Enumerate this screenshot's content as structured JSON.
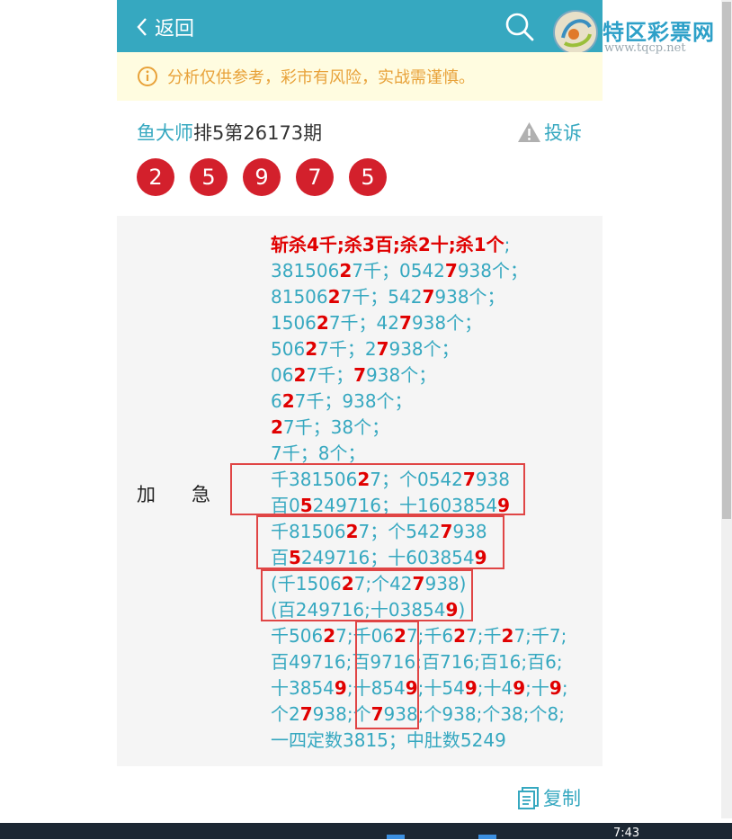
{
  "header": {
    "back_label": "返回"
  },
  "brand": {
    "name": "特区彩票网",
    "url": "www.tqcp.net"
  },
  "notice": {
    "text": "分析仅供参考，彩市有风险，实战需谨慎。"
  },
  "post": {
    "author": "鱼大师",
    "title": "排5第26173期",
    "complain_label": "投诉",
    "balls": [
      "2",
      "5",
      "9",
      "7",
      "5"
    ],
    "tag": "加急",
    "copy_label": "复制"
  },
  "content": {
    "lines": [
      [
        [
          "斩杀4千;杀3百;杀2十;杀1个",
          true
        ],
        [
          ";",
          false
        ]
      ],
      [
        [
          "381506",
          false
        ],
        [
          "2",
          true
        ],
        [
          "7千；0542",
          false
        ],
        [
          "7",
          true
        ],
        [
          "938个；",
          false
        ]
      ],
      [
        [
          "81506",
          false
        ],
        [
          "2",
          true
        ],
        [
          "7千；542",
          false
        ],
        [
          "7",
          true
        ],
        [
          "938个；",
          false
        ]
      ],
      [
        [
          "1506",
          false
        ],
        [
          "2",
          true
        ],
        [
          "7千；42",
          false
        ],
        [
          "7",
          true
        ],
        [
          "938个；",
          false
        ]
      ],
      [
        [
          "506",
          false
        ],
        [
          "2",
          true
        ],
        [
          "7千；2",
          false
        ],
        [
          "7",
          true
        ],
        [
          "938个；",
          false
        ]
      ],
      [
        [
          "06",
          false
        ],
        [
          "2",
          true
        ],
        [
          "7千；",
          false
        ],
        [
          "7",
          true
        ],
        [
          "938个；",
          false
        ]
      ],
      [
        [
          "6",
          false
        ],
        [
          "2",
          true
        ],
        [
          "7千；938个；",
          false
        ]
      ],
      [
        [
          "2",
          true
        ],
        [
          "7千；38个；",
          false
        ]
      ],
      [
        [
          "7千；8个；",
          false
        ]
      ],
      [
        [
          "千381506",
          false
        ],
        [
          "2",
          true
        ],
        [
          "7；个0542",
          false
        ],
        [
          "7",
          true
        ],
        [
          "938",
          false
        ]
      ],
      [
        [
          "百0",
          false
        ],
        [
          "5",
          true
        ],
        [
          "249716；十1603854",
          false
        ],
        [
          "9",
          true
        ]
      ],
      [
        [
          "千81506",
          false
        ],
        [
          "2",
          true
        ],
        [
          "7；个542",
          false
        ],
        [
          "7",
          true
        ],
        [
          "938",
          false
        ]
      ],
      [
        [
          "百",
          false
        ],
        [
          "5",
          true
        ],
        [
          "249716；十603854",
          false
        ],
        [
          "9",
          true
        ]
      ],
      [
        [
          "(千1506",
          false
        ],
        [
          "2",
          true
        ],
        [
          "7;个42",
          false
        ],
        [
          "7",
          true
        ],
        [
          "938)",
          false
        ]
      ],
      [
        [
          "(百249716;十03854",
          false
        ],
        [
          "9",
          true
        ],
        [
          ")",
          false
        ]
      ],
      [
        [
          "千506",
          false
        ],
        [
          "2",
          true
        ],
        [
          "7;千06",
          false
        ],
        [
          "2",
          true
        ],
        [
          "7;千6",
          false
        ],
        [
          "2",
          true
        ],
        [
          "7;千",
          false
        ],
        [
          "2",
          true
        ],
        [
          "7;千7;",
          false
        ]
      ],
      [
        [
          "百49716;百9716;百716;百16;百6;",
          false
        ]
      ],
      [
        [
          "十3854",
          false
        ],
        [
          "9",
          true
        ],
        [
          ";十854",
          false
        ],
        [
          "9",
          true
        ],
        [
          ";十54",
          false
        ],
        [
          "9",
          true
        ],
        [
          ";十4",
          false
        ],
        [
          "9",
          true
        ],
        [
          ";十",
          false
        ],
        [
          "9",
          true
        ],
        [
          ";",
          false
        ]
      ],
      [
        [
          "个2",
          false
        ],
        [
          "7",
          true
        ],
        [
          "938;个",
          false
        ],
        [
          "7",
          true
        ],
        [
          "938;个938;个38;个8;",
          false
        ]
      ],
      [
        [
          "一四定数3815；中肚数5249",
          false
        ]
      ]
    ]
  },
  "taskbar": {
    "time": "7:43"
  },
  "colors": {
    "header": "#36a8c0",
    "accent": "#36a8c0",
    "ball": "#d3202c",
    "highlight": "#e00000",
    "box_border": "#e04545",
    "notice_bg": "#fffce0",
    "notice_text": "#e8a23a"
  },
  "icons": {
    "back": "chevron-left-icon",
    "search": "search-icon",
    "info": "info-icon",
    "warning": "warning-icon",
    "copy": "copy-icon"
  }
}
